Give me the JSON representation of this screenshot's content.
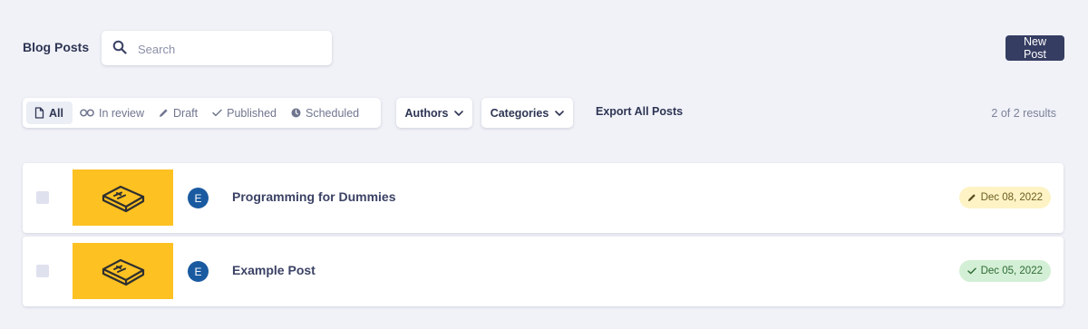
{
  "header": {
    "title": "Blog Posts",
    "search_placeholder": "Search",
    "new_post_label": "New Post"
  },
  "filters": {
    "tabs": [
      {
        "label": "All",
        "icon": "file-icon",
        "active": true
      },
      {
        "label": "In review",
        "icon": "glasses-icon",
        "active": false
      },
      {
        "label": "Draft",
        "icon": "pencil-icon",
        "active": false
      },
      {
        "label": "Published",
        "icon": "check-icon",
        "active": false
      },
      {
        "label": "Scheduled",
        "icon": "clock-icon",
        "active": false
      }
    ],
    "authors_label": "Authors",
    "categories_label": "Categories",
    "export_label": "Export All Posts",
    "results_text": "2 of 2 results"
  },
  "posts": [
    {
      "title": "Programming for Dummies",
      "author_initial": "E",
      "date": "Dec 08, 2022",
      "status": "draft",
      "status_icon": "pencil-icon",
      "thumbnail_icon": "box-icon"
    },
    {
      "title": "Example Post",
      "author_initial": "E",
      "date": "Dec 05, 2022",
      "status": "published",
      "status_icon": "check-icon",
      "thumbnail_icon": "box-icon"
    }
  ],
  "colors": {
    "background": "#f1f2f8",
    "primary": "#353d62",
    "thumbnail": "#fdc122",
    "avatar": "#1a5aa0",
    "draft_badge": "#fdf3c5",
    "published_badge": "#d3efd5"
  }
}
